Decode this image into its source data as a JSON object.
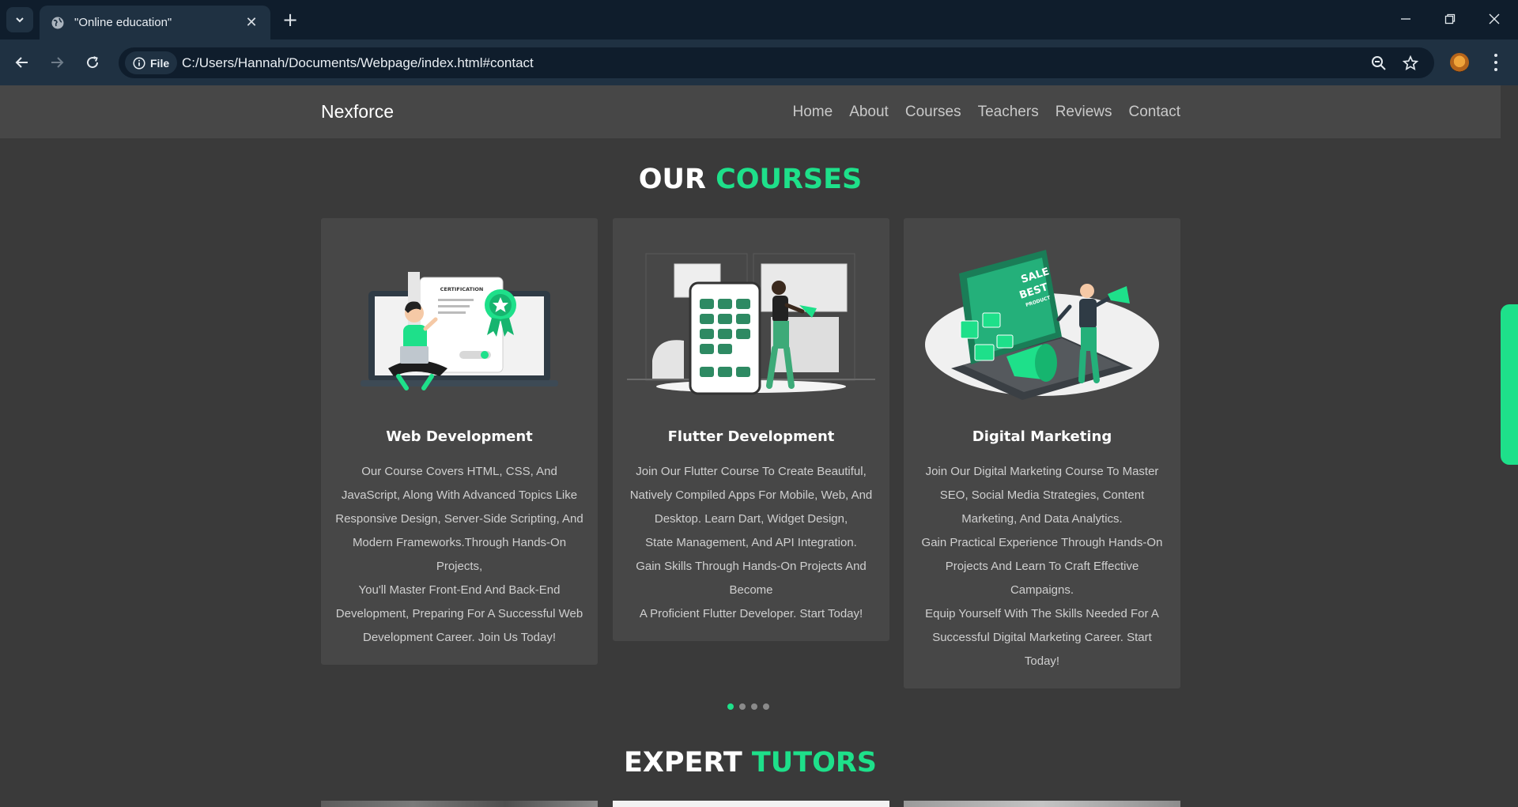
{
  "browser": {
    "tab_title": "\"Online education\"",
    "tab_close": "✕",
    "new_tab": "+",
    "site_chip_label": "File",
    "url": "C:/Users/Hannah/Documents/Webpage/index.html#contact"
  },
  "site": {
    "brand": "Nexforce",
    "nav": [
      "Home",
      "About",
      "Courses",
      "Teachers",
      "Reviews",
      "Contact"
    ]
  },
  "courses_section": {
    "title_white": "OUR",
    "title_green": "COURSES",
    "cards": [
      {
        "title": "Web Development",
        "body": [
          "Our Course Covers HTML, CSS, And JavaScript, Along With Advanced Topics Like Responsive Design, Server-Side Scripting, And Modern Frameworks.Through Hands-On Projects,",
          "You'll Master Front-End And Back-End Development, Preparing For A Successful Web Development Career. Join Us Today!"
        ],
        "illustration": "certification-illustration"
      },
      {
        "title": "Flutter Development",
        "body": [
          "Join Our Flutter Course To Create Beautiful, Natively Compiled Apps For Mobile, Web, And Desktop. Learn Dart, Widget Design,",
          "State Management, And API Integration.",
          "Gain Skills Through Hands-On Projects And Become",
          "A Proficient Flutter Developer. Start Today!"
        ],
        "illustration": "mobile-app-illustration"
      },
      {
        "title": "Digital Marketing",
        "body": [
          "Join Our Digital Marketing Course To Master SEO, Social Media Strategies, Content Marketing, And Data Analytics.",
          "Gain Practical Experience Through Hands-On Projects And Learn To Craft Effective Campaigns.",
          "Equip Yourself With The Skills Needed For A Successful Digital Marketing Career. Start Today!"
        ],
        "illustration": "marketing-illustration",
        "image_text": [
          "SALE",
          "BEST",
          "PRODUCT"
        ]
      }
    ],
    "carousel": {
      "pages": 4,
      "active": 1
    }
  },
  "tutors_section": {
    "title_white": "EXPERT",
    "title_green": "TUTORS"
  },
  "colors": {
    "accent": "#1ee08a",
    "page_bg": "#3a3a3a",
    "card_bg": "#474747",
    "chrome_dark": "#0f1d2c",
    "chrome_mid": "#1f3142"
  }
}
